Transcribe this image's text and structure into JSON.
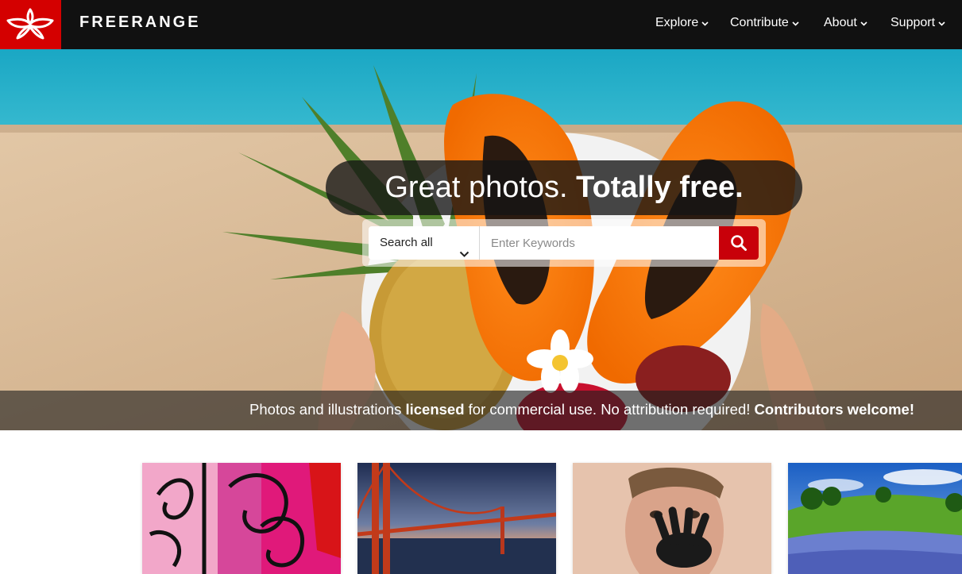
{
  "brand": {
    "name": "FREERANGE",
    "logo_icon": "freerange-logo-icon",
    "accent": "#d40000"
  },
  "nav": {
    "items": [
      {
        "label": "Explore"
      },
      {
        "label": "Contribute"
      },
      {
        "label": "About"
      },
      {
        "label": "Support"
      }
    ],
    "caret_icon": "chevron-down-icon"
  },
  "hero": {
    "headline_regular": "Great photos.",
    "headline_bold": "Totally free.",
    "search": {
      "scope_selected": "Search all",
      "placeholder": "Enter Keywords",
      "button_icon": "search-icon",
      "button_color": "#c8000a"
    },
    "tagline": {
      "part1": "Photos and illustrations",
      "part2": "licensed",
      "part3": "for commercial use. No attribution required!",
      "part4": "Contributors welcome!"
    }
  },
  "thumbnails": [
    {
      "subject": "pink graffiti wall"
    },
    {
      "subject": "Golden Gate Bridge at dusk"
    },
    {
      "subject": "boy with black handprint on face"
    },
    {
      "subject": "green hills with blue wildflowers"
    }
  ]
}
